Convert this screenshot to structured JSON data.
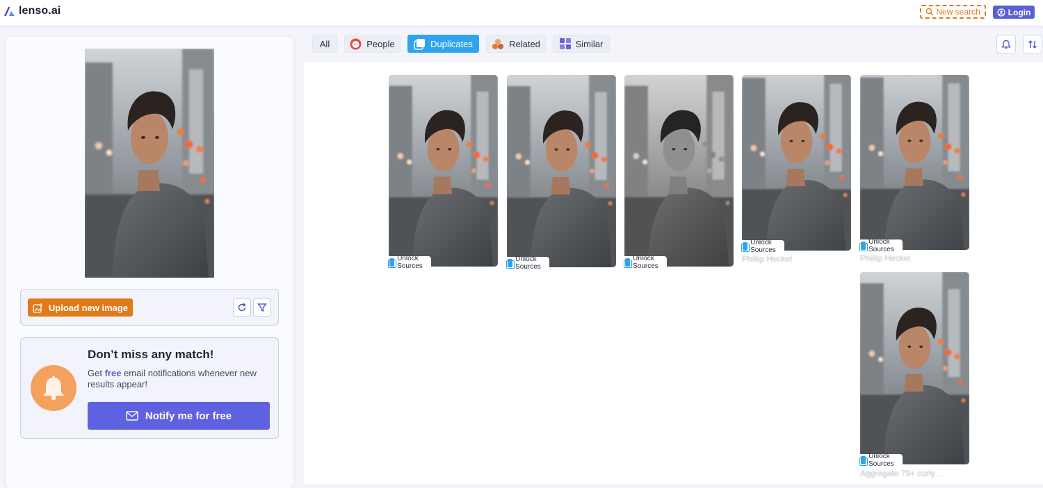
{
  "header": {
    "logo_text": "lenso.ai",
    "new_search_label": "New search",
    "login_label": "Login"
  },
  "left": {
    "upload_label": "Upload new image",
    "notify_title": "Don’t miss any match!",
    "notify_text_before": "Get",
    "notify_text_free": "free",
    "notify_text_after": "email notifications whenever new results appear!",
    "notify_button": "Notify me for free"
  },
  "tabs": [
    {
      "label": "All"
    },
    {
      "label": "People",
      "icon": "people-icon"
    },
    {
      "label": "Duplicates",
      "icon": "duplicates-icon",
      "active": true
    },
    {
      "label": "Related",
      "icon": "related-icon"
    },
    {
      "label": "Similar",
      "icon": "similar-icon"
    }
  ],
  "results": [
    {
      "unlock_label": "Unlock Sources",
      "caption": "",
      "tint": "color"
    },
    {
      "unlock_label": "Unlock Sources",
      "caption": "",
      "tint": "color"
    },
    {
      "unlock_label": "Unlock Sources",
      "caption": "",
      "tint": "gray"
    },
    {
      "unlock_label": "Unlock Sources",
      "caption": "Phillip Heckel",
      "tint": "color"
    },
    {
      "unlock_label": "Unlock Sources",
      "caption": "Phillip Heckel",
      "tint": "color"
    },
    {
      "unlock_label": "Unlock Sources",
      "caption": "Aggregate 79+ curly ...",
      "tint": "color"
    }
  ],
  "colors": {
    "accent_orange": "#e07b1a",
    "accent_purple": "#5e62e0",
    "accent_blue": "#31a3ee"
  }
}
